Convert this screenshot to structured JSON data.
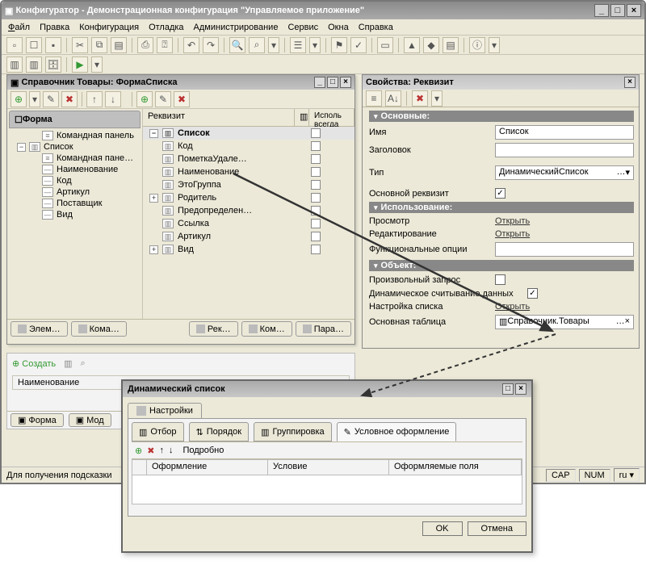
{
  "window": {
    "title": "Конфигуратор - Демонстрационная конфигурация \"Управляемое приложение\""
  },
  "menu": {
    "file": "Файл",
    "edit": "Правка",
    "config": "Конфигурация",
    "debug": "Отладка",
    "admin": "Администрирование",
    "service": "Сервис",
    "windows": "Окна",
    "help": "Справка"
  },
  "left": {
    "title": "Справочник Товары: ФормаСписка",
    "form_root": "Форма",
    "tree": [
      {
        "exp": "",
        "icon": "≡",
        "label": "Командная панель",
        "ind": 1
      },
      {
        "exp": "−",
        "icon": "▥",
        "label": "Список",
        "ind": 0
      },
      {
        "exp": "",
        "icon": "≡",
        "label": "Командная пане…",
        "ind": 1
      },
      {
        "exp": "",
        "icon": "—",
        "label": "Наименование",
        "ind": 1
      },
      {
        "exp": "",
        "icon": "—",
        "label": "Код",
        "ind": 1
      },
      {
        "exp": "",
        "icon": "—",
        "label": "Артикул",
        "ind": 1
      },
      {
        "exp": "",
        "icon": "—",
        "label": "Поставщик",
        "ind": 1
      },
      {
        "exp": "",
        "icon": "—",
        "label": "Вид",
        "ind": 1
      }
    ],
    "rekv_header": "Реквизит",
    "rekv_col2": "Исполь\nвсегда",
    "rekv": [
      {
        "exp": "−",
        "label": "Список",
        "sel": true,
        "chk": true
      },
      {
        "exp": "",
        "label": "Код",
        "chk": true
      },
      {
        "exp": "",
        "label": "ПометкаУдале…",
        "chk": true
      },
      {
        "exp": "",
        "label": "Наименование",
        "chk": true
      },
      {
        "exp": "",
        "label": "ЭтоГруппа",
        "chk": true
      },
      {
        "exp": "+",
        "label": "Родитель",
        "chk": true
      },
      {
        "exp": "",
        "label": "Предопределен…",
        "chk": true
      },
      {
        "exp": "",
        "label": "Ссылка",
        "chk": true
      },
      {
        "exp": "",
        "label": "Артикул",
        "chk": true
      },
      {
        "exp": "+",
        "label": "Вид",
        "chk": true
      }
    ],
    "tabs_left": [
      "Элем…",
      "Кома…"
    ],
    "tabs_right": [
      "Рек…",
      "Ком…",
      "Пара…"
    ],
    "create": "Создать",
    "lower_hdr": "Наименование",
    "bottom_tabs": [
      "Форма",
      "Мод"
    ]
  },
  "props": {
    "title": "Свойства: Реквизит",
    "sec_main": "Основные:",
    "name_label": "Имя",
    "name_value": "Список",
    "header_label": "Заголовок",
    "header_value": "",
    "type_label": "Тип",
    "type_value": "ДинамическийСписок",
    "main_rekv": "Основной реквизит",
    "sec_use": "Использование:",
    "view": "Просмотр",
    "view_link": "Открыть",
    "edit": "Редактирование",
    "edit_link": "Открыть",
    "funcopt": "Функциональные опции",
    "sec_obj": "Объект:",
    "arb_query": "Произвольный запрос",
    "dyn_read": "Динамическое считывание данных",
    "list_setup": "Настройка списка",
    "list_setup_link": "Открыть",
    "main_table": "Основная таблица",
    "main_table_value": "Справочник.Товары"
  },
  "dialog": {
    "title": "Динамический список",
    "tab": "Настройки",
    "subtabs": [
      "Отбор",
      "Порядок",
      "Группировка",
      "Условное оформление"
    ],
    "detail": "Подробно",
    "cols": [
      "Оформление",
      "Условие",
      "Оформляемые поля"
    ],
    "ok": "OK",
    "cancel": "Отмена"
  },
  "status": {
    "hint": "Для получения подсказки",
    "cap": "CAP",
    "num": "NUM",
    "lang": "ru"
  }
}
